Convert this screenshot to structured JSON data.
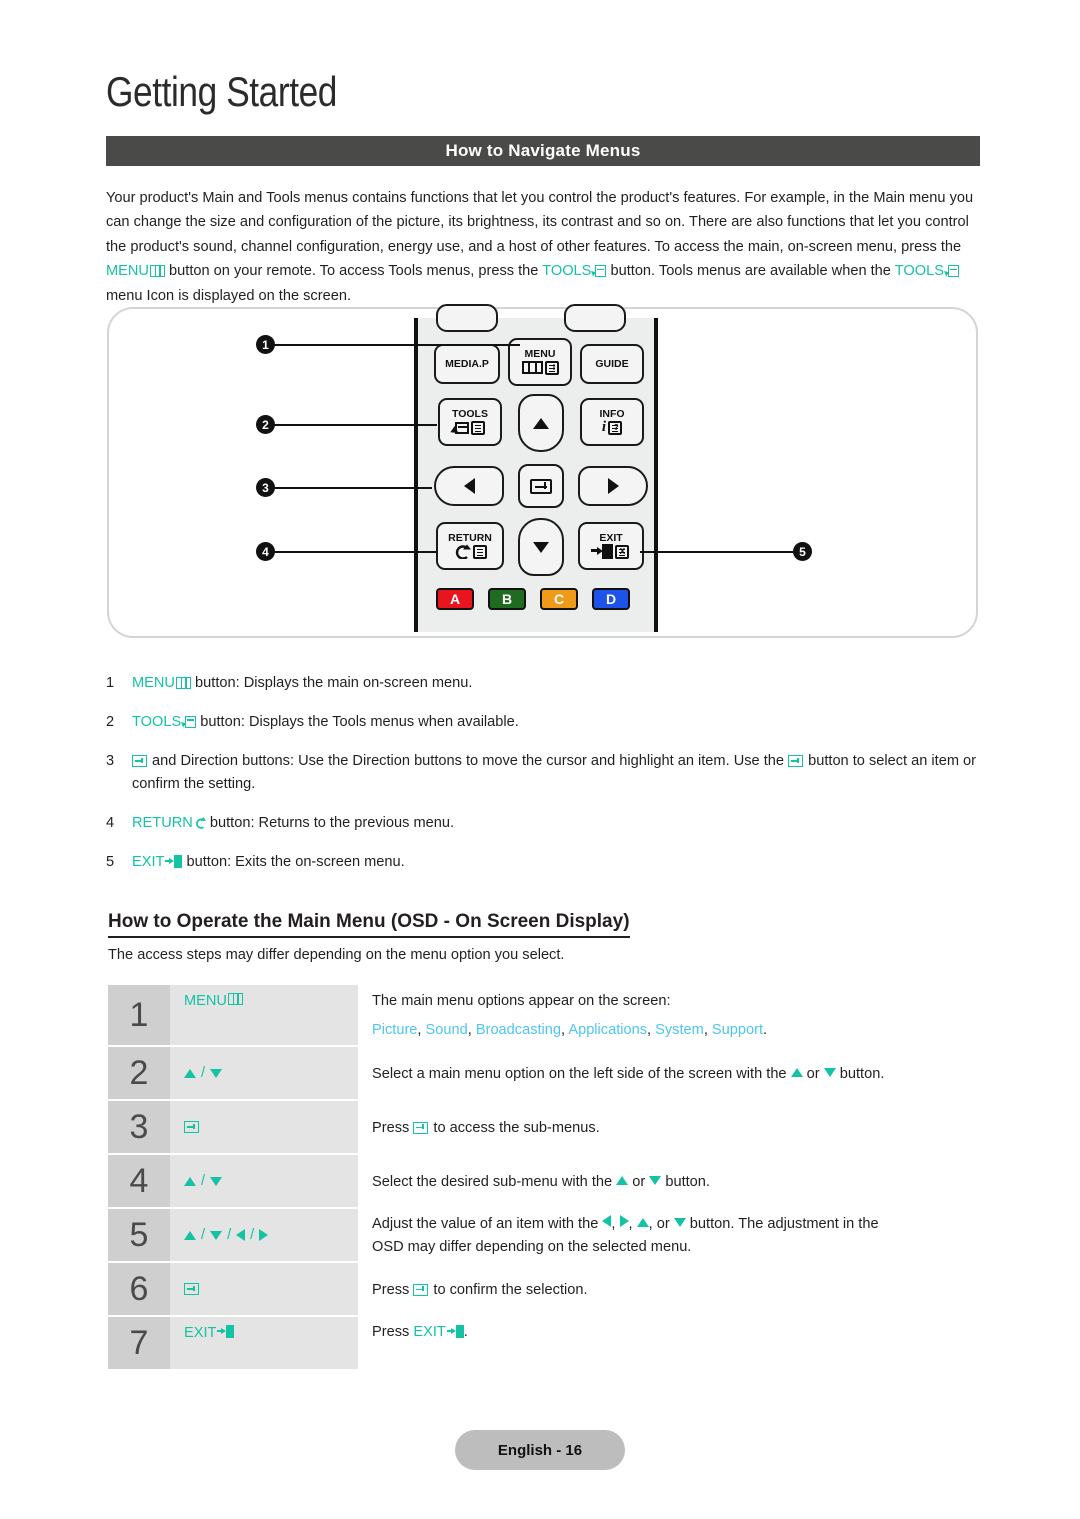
{
  "header": {
    "chapter_title": "Getting Started",
    "section_bar_title": "How to Navigate Menus"
  },
  "intro": {
    "p1": "Your product's Main and Tools menus contains functions that let you control the product's features. For example, in the",
    "p2": "Main menu you can change the size and configuration of the picture, its brightness, its contrast and so on. There are",
    "p3": "also functions that let you control the product's sound, channel configuration, energy use, and a host of other features.",
    "p4_a": "To access the main, on-screen menu, press the ",
    "p4_menu": "MENU",
    "p4_b": " button on your remote. To access Tools menus, press the",
    "p5_tools1": "TOOLS",
    "p5_a": " button. Tools menus are available when the ",
    "p5_tools2": "TOOLS",
    "p5_b": " menu Icon is displayed on the screen."
  },
  "remote": {
    "buttons": {
      "media_p": "MEDIA.P",
      "menu": "MENU",
      "guide": "GUIDE",
      "tools": "TOOLS",
      "info": "INFO",
      "info_i": "i",
      "info_q": "?",
      "return": "RETURN",
      "exit": "EXIT",
      "exit_x": "X"
    },
    "color_buttons": [
      {
        "label": "A",
        "color": "#e8141e"
      },
      {
        "label": "B",
        "color": "#1f6b1f"
      },
      {
        "label": "C",
        "color": "#ef9a18"
      },
      {
        "label": "D",
        "color": "#1e52e8"
      }
    ],
    "callouts": [
      "1",
      "2",
      "3",
      "4",
      "5"
    ]
  },
  "legend": [
    {
      "num": "1",
      "key": "MENU",
      "icon": "menu-grid-icon",
      "text": " button: Displays the main on-screen menu."
    },
    {
      "num": "2",
      "key": "TOOLS",
      "icon": "tools-icon",
      "text": " button: Displays the Tools menus when available."
    },
    {
      "num": "3",
      "key": "",
      "icon": "enter-icon",
      "text_a": " and Direction buttons: Use the Direction buttons to move the cursor and highlight an item. Use the ",
      "text_b": " button to select an item or confirm the setting."
    },
    {
      "num": "4",
      "key": "RETURN",
      "icon": "return-icon",
      "text": " button: Returns to the previous menu."
    },
    {
      "num": "5",
      "key": "EXIT",
      "icon": "exit-icon",
      "text": " button: Exits the on-screen menu."
    }
  ],
  "osd": {
    "heading": "How to Operate the Main Menu (OSD - On Screen Display)",
    "subtitle": "The access steps may differ depending on the menu option you select.",
    "steps": [
      {
        "num": "1",
        "key_label": "MENU",
        "key_icon": "menu-grid-icon",
        "desc_line1": "The main menu options appear on the screen:",
        "menu_options": [
          "Picture",
          "Sound",
          "Broadcasting",
          "Applications",
          "System",
          "Support"
        ],
        "desc_tail": "."
      },
      {
        "num": "2",
        "key_label": "",
        "key_icon": "up-down-arrows",
        "desc_a": "Select a main menu option on the left side of the screen with the ",
        "desc_mid": " or ",
        "desc_b": " button."
      },
      {
        "num": "3",
        "key_label": "",
        "key_icon": "enter-icon",
        "desc_a": "Press ",
        "desc_b": " to access the sub-menus."
      },
      {
        "num": "4",
        "key_label": "",
        "key_icon": "up-down-arrows",
        "desc_a": "Select the desired sub-menu with the ",
        "desc_mid": " or ",
        "desc_b": " button."
      },
      {
        "num": "5",
        "key_label": "",
        "key_icon": "four-direction-arrows",
        "desc_a": "Adjust the value of an item with the ",
        "desc_b": ", ",
        "desc_c": ", ",
        "desc_d": ", or ",
        "desc_e": " button. The adjustment in the",
        "desc_line2": "OSD may differ depending on the selected menu."
      },
      {
        "num": "6",
        "key_label": "",
        "key_icon": "enter-icon",
        "desc_a": "Press ",
        "desc_b": " to confirm the selection."
      },
      {
        "num": "7",
        "key_label": "EXIT",
        "key_icon": "exit-icon",
        "desc_a": "Press ",
        "desc_b": "EXIT",
        "desc_c": "."
      }
    ]
  },
  "footer": {
    "page_label": "English - 16"
  },
  "colors": {
    "teal": "#14c2a4",
    "light_blue": "#4dc6f0",
    "section_bar": "#4a4a49",
    "step_num_bg": "#cfcfcf",
    "step_key_bg": "#e4e4e4",
    "footer_bg": "#bdbdbd"
  }
}
